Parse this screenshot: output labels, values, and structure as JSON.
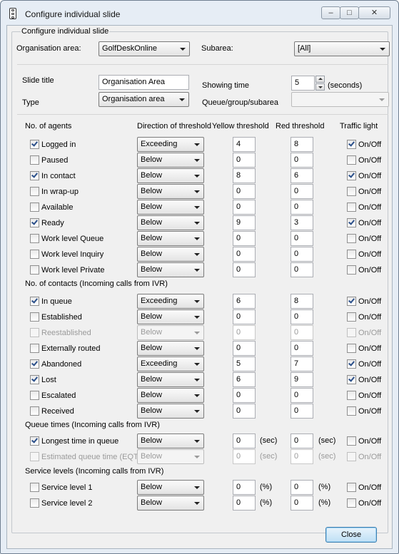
{
  "window": {
    "title": "Configure individual slide",
    "controls": [
      "minimize-icon",
      "maximize-icon",
      "close-icon"
    ]
  },
  "group_title": "Configure individual slide",
  "top": {
    "org_area_label": "Organisation area:",
    "org_area_value": "GolfDeskOnline",
    "subarea_label": "Subarea:",
    "subarea_value": "[All]"
  },
  "slide": {
    "title_label": "Slide title",
    "title_value": "Organisation Area",
    "type_label": "Type",
    "type_value": "Organisation area",
    "showing_time_label": "Showing time",
    "showing_time_value": "5",
    "showing_time_unit": "(seconds)",
    "queue_label": "Queue/group/subarea",
    "queue_value": ""
  },
  "headers": {
    "agents": "No. of agents",
    "direction": "Direction of threshold",
    "yellow": "Yellow threshold",
    "red": "Red threshold",
    "traffic": "Traffic light"
  },
  "sections": {
    "contacts": "No. of contacts (Incoming calls from IVR)",
    "queue_times": "Queue times (Incoming calls from IVR)",
    "service_levels": "Service levels (Incoming calls from IVR)"
  },
  "onoff_label": "On/Off",
  "rows": [
    {
      "label": "Logged in",
      "checked": true,
      "direction": "Exceeding",
      "yellow": "4",
      "red": "8",
      "light": true,
      "enabled": true
    },
    {
      "label": "Paused",
      "checked": false,
      "direction": "Below",
      "yellow": "0",
      "red": "0",
      "light": false,
      "enabled": true
    },
    {
      "label": "In contact",
      "checked": true,
      "direction": "Below",
      "yellow": "8",
      "red": "6",
      "light": true,
      "enabled": true
    },
    {
      "label": "In wrap-up",
      "checked": false,
      "direction": "Below",
      "yellow": "0",
      "red": "0",
      "light": false,
      "enabled": true
    },
    {
      "label": "Available",
      "checked": false,
      "direction": "Below",
      "yellow": "0",
      "red": "0",
      "light": false,
      "enabled": true
    },
    {
      "label": "Ready",
      "checked": true,
      "direction": "Below",
      "yellow": "9",
      "red": "3",
      "light": true,
      "enabled": true
    },
    {
      "label": "Work level Queue",
      "checked": false,
      "direction": "Below",
      "yellow": "0",
      "red": "0",
      "light": false,
      "enabled": true
    },
    {
      "label": "Work level Inquiry",
      "checked": false,
      "direction": "Below",
      "yellow": "0",
      "red": "0",
      "light": false,
      "enabled": true
    },
    {
      "label": "Work level Private",
      "checked": false,
      "direction": "Below",
      "yellow": "0",
      "red": "0",
      "light": false,
      "enabled": true
    },
    {
      "label": "In queue",
      "checked": true,
      "direction": "Exceeding",
      "yellow": "6",
      "red": "8",
      "light": true,
      "enabled": true
    },
    {
      "label": "Established",
      "checked": false,
      "direction": "Below",
      "yellow": "0",
      "red": "0",
      "light": false,
      "enabled": true
    },
    {
      "label": "Reestablished",
      "checked": false,
      "direction": "Below",
      "yellow": "0",
      "red": "0",
      "light": false,
      "enabled": false
    },
    {
      "label": "Externally routed",
      "checked": false,
      "direction": "Below",
      "yellow": "0",
      "red": "0",
      "light": false,
      "enabled": true
    },
    {
      "label": "Abandoned",
      "checked": true,
      "direction": "Exceeding",
      "yellow": "5",
      "red": "7",
      "light": true,
      "enabled": true
    },
    {
      "label": "Lost",
      "checked": true,
      "direction": "Below",
      "yellow": "6",
      "red": "9",
      "light": true,
      "enabled": true
    },
    {
      "label": "Escalated",
      "checked": false,
      "direction": "Below",
      "yellow": "0",
      "red": "0",
      "light": false,
      "enabled": true
    },
    {
      "label": "Received",
      "checked": false,
      "direction": "Below",
      "yellow": "0",
      "red": "0",
      "light": false,
      "enabled": true
    },
    {
      "label": "Longest time in queue",
      "checked": true,
      "direction": "Below",
      "yellow": "0",
      "red": "0",
      "unit": "(sec)",
      "light": false,
      "enabled": true
    },
    {
      "label": "Estimated queue time (EQT)",
      "checked": false,
      "direction": "Below",
      "yellow": "0",
      "red": "0",
      "unit": "(sec)",
      "light": false,
      "enabled": false
    },
    {
      "label": "Service level 1",
      "checked": false,
      "direction": "Below",
      "yellow": "0",
      "red": "0",
      "unit": "(%)",
      "light": false,
      "enabled": true
    },
    {
      "label": "Service level 2",
      "checked": false,
      "direction": "Below",
      "yellow": "0",
      "red": "0",
      "unit": "(%)",
      "light": false,
      "enabled": true
    }
  ],
  "close_label": "Close"
}
